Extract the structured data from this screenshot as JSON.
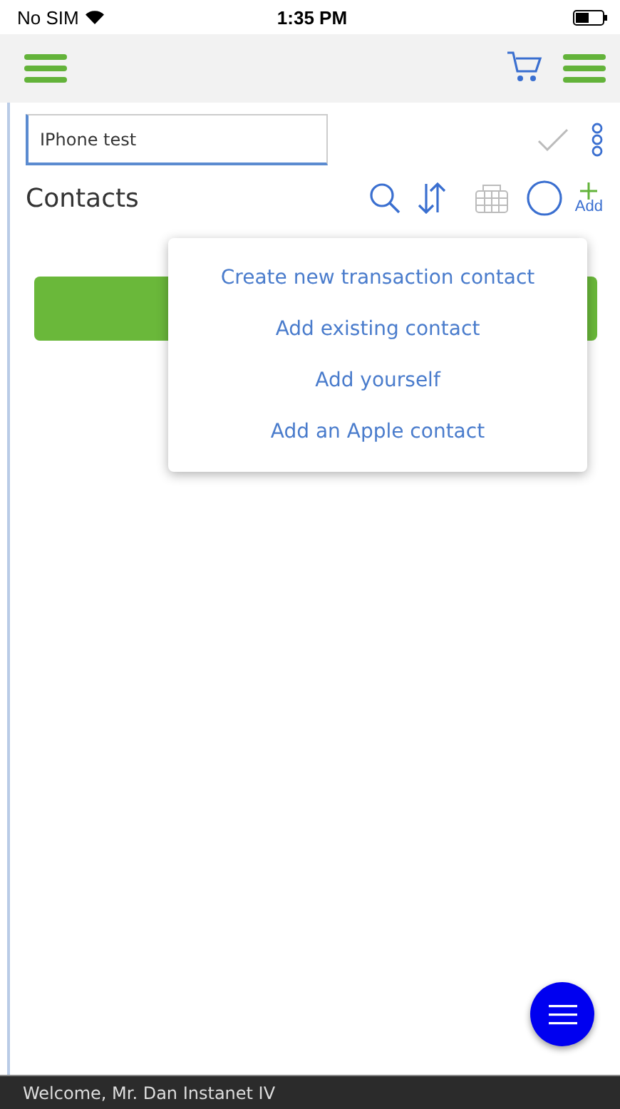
{
  "status_bar": {
    "carrier": "No SIM",
    "time": "1:35 PM"
  },
  "title_field": {
    "value": "IPhone test"
  },
  "section": {
    "title": "Contacts",
    "add_label": "Add"
  },
  "add_menu": {
    "open": true,
    "items": [
      "Create new transaction contact",
      "Add existing contact",
      "Add yourself",
      "Add an Apple contact"
    ]
  },
  "footer": {
    "welcome": "Welcome, Mr. Dan Instanet IV"
  }
}
